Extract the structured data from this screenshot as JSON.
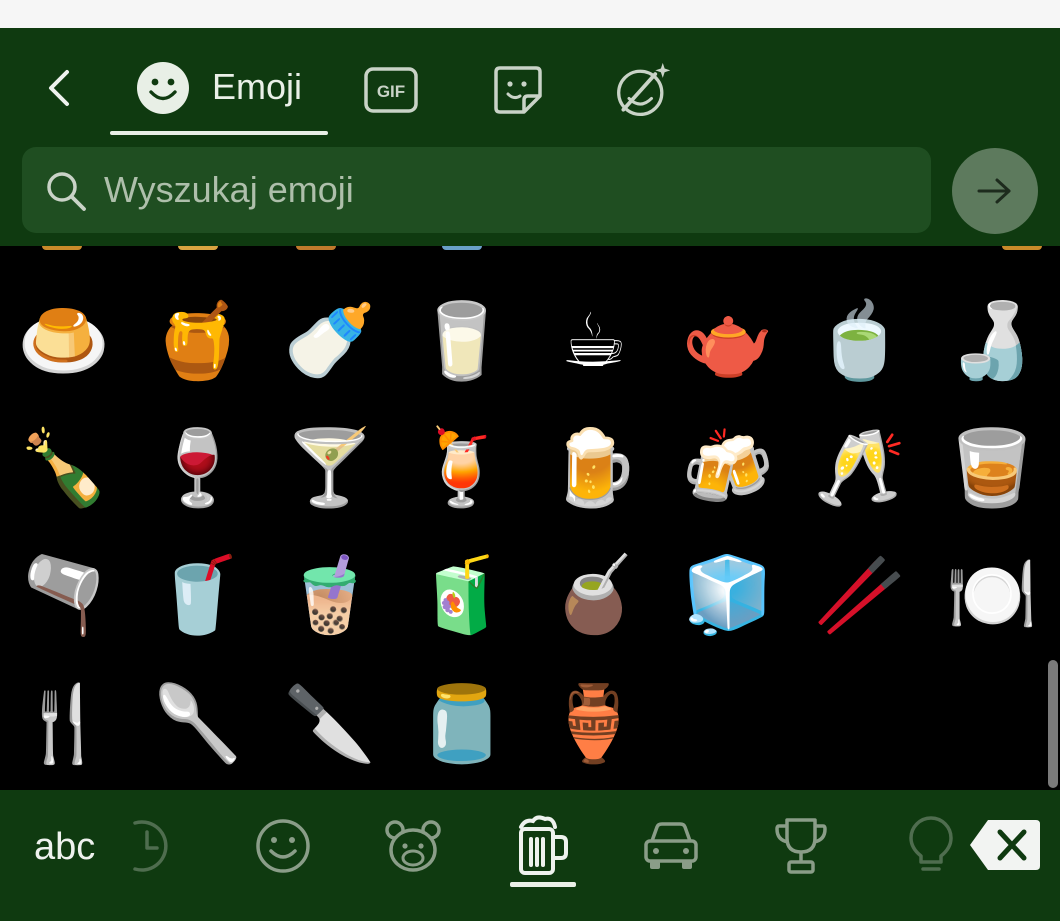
{
  "header": {
    "tab_emoji_label": "Emoji",
    "tab_gif_label": "GIF",
    "search_placeholder": "Wyszukaj emoji"
  },
  "emoji_rows": [
    [
      "🍮",
      "🍯",
      "🍼",
      "🥛",
      "☕",
      "🫖",
      "🍵",
      "🍶"
    ],
    [
      "🍾",
      "🍷",
      "🍸",
      "🍹",
      "🍺",
      "🍻",
      "🥂",
      "🥃"
    ],
    [
      "🫗",
      "🥤",
      "🧋",
      "🧃",
      "🧉",
      "🧊",
      "🥢",
      "🍽️"
    ],
    [
      "🍴",
      "🥄",
      "🔪",
      "🫙",
      "🏺"
    ]
  ],
  "bottom_bar": {
    "abc_label": "abc",
    "categories": [
      "recent",
      "smileys",
      "animals",
      "food-drink",
      "travel",
      "activities",
      "objects"
    ],
    "active_category": "food-drink"
  },
  "colors": {
    "bar_background": "#0f3a10",
    "search_background": "#1f4e21",
    "grid_background": "#000000"
  }
}
